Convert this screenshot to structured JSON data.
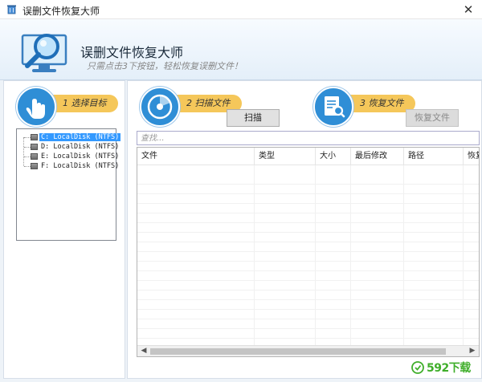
{
  "window": {
    "title": "误删文件恢复大师",
    "close_glyph": "✕"
  },
  "header": {
    "app_name": "误删文件恢复大师",
    "slogan": "只需点击3下按钮，轻松恢复误删文件！",
    "logo_icon": "magnifier-monitor-icon"
  },
  "steps": [
    {
      "label": "1 选择目标",
      "icon": "hand-pointer-icon"
    },
    {
      "label": "2 扫描文件",
      "icon": "scan-disc-icon"
    },
    {
      "label": "3 恢复文件",
      "icon": "document-search-icon"
    }
  ],
  "buttons": {
    "scan": "扫描",
    "restore": "恢复文件",
    "restore_disabled": true
  },
  "drives": [
    {
      "label": "C: LocalDisk (NTFS)",
      "selected": true
    },
    {
      "label": "D: LocalDisk (NTFS)",
      "selected": false
    },
    {
      "label": "E: LocalDisk (NTFS)",
      "selected": false
    },
    {
      "label": "F: LocalDisk (NTFS)",
      "selected": false
    }
  ],
  "search": {
    "placeholder": "查找...",
    "value": ""
  },
  "table": {
    "columns": [
      "文件",
      "类型",
      "大小",
      "最后修改",
      "路径",
      "恢复"
    ]
  },
  "watermark": {
    "text": "592下载"
  },
  "colors": {
    "accent_blue": "#2f8ed6",
    "step_banner": "#f5c75a",
    "selection": "#3399ff",
    "watermark_green": "#3fae2a"
  }
}
